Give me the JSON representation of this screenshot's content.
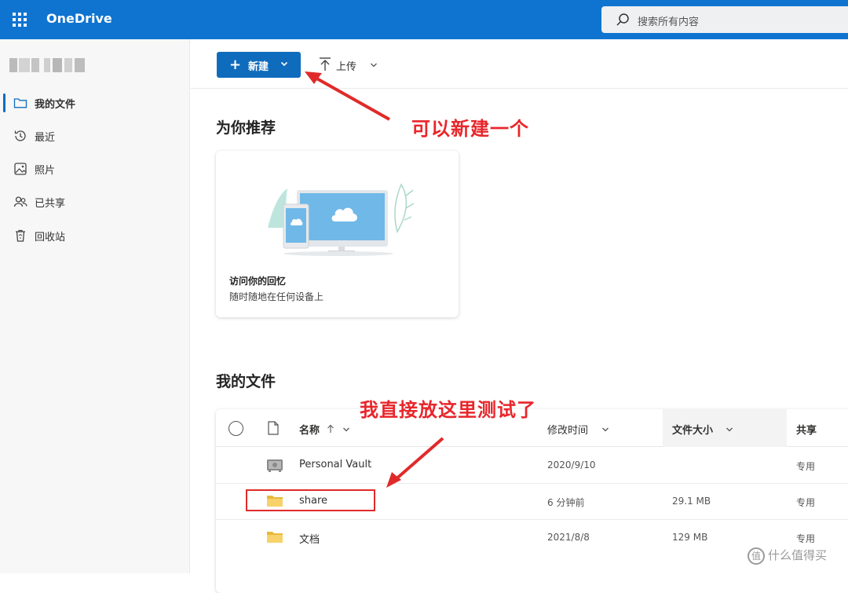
{
  "app": {
    "name": "OneDrive"
  },
  "search": {
    "placeholder": "搜索所有内容"
  },
  "sidebar": {
    "items": [
      {
        "label": "我的文件",
        "icon": "folder-icon",
        "active": true
      },
      {
        "label": "最近",
        "icon": "history-icon"
      },
      {
        "label": "照片",
        "icon": "photo-icon"
      },
      {
        "label": "已共享",
        "icon": "people-icon"
      },
      {
        "label": "回收站",
        "icon": "recycle-bin-icon"
      }
    ]
  },
  "toolbar": {
    "new_label": "新建",
    "upload_label": "上传"
  },
  "recommended": {
    "heading": "为你推荐",
    "card": {
      "title": "访问你的回忆",
      "subtitle": "随时随地在任何设备上"
    }
  },
  "files": {
    "heading": "我的文件",
    "columns": {
      "name": "名称",
      "modified": "修改时间",
      "size": "文件大小",
      "sharing": "共享"
    },
    "rows": [
      {
        "name": "Personal Vault",
        "modified": "2020/9/10",
        "size": "",
        "sharing": "专用",
        "icon": "vault-icon"
      },
      {
        "name": "share",
        "modified": "6 分钟前",
        "size": "29.1 MB",
        "sharing": "专用",
        "icon": "folder-icon"
      },
      {
        "name": "文档",
        "modified": "2021/8/8",
        "size": "129 MB",
        "sharing": "专用",
        "icon": "folder-icon"
      }
    ]
  },
  "annotations": {
    "new_hint": "可以新建一个",
    "share_hint": "我直接放这里测试了"
  },
  "watermark": {
    "circle": "值",
    "text": "什么值得买"
  },
  "colors": {
    "brand": "#0f74d0",
    "annotation": "#e8262b"
  }
}
